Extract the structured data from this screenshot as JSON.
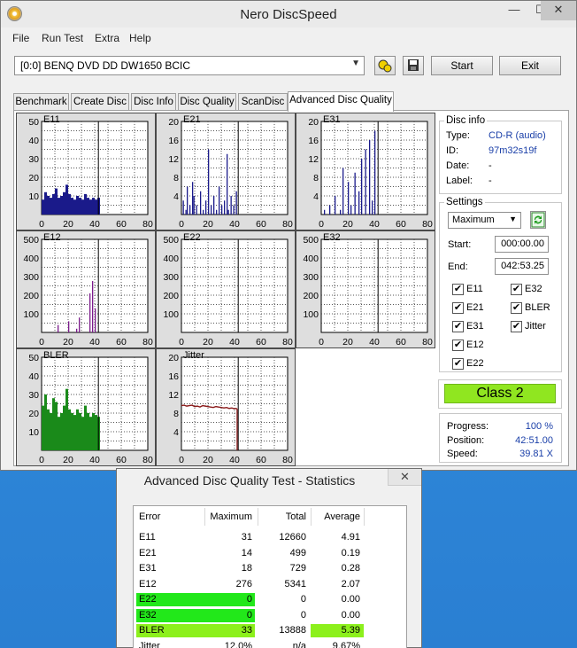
{
  "window": {
    "title": "Nero DiscSpeed",
    "minimize": "—",
    "maximize": "☐",
    "close": "✕"
  },
  "menu": [
    "File",
    "Run Test",
    "Extra",
    "Help"
  ],
  "toolbar": {
    "drive": "[0:0]   BENQ DVD DD DW1650 BCIC",
    "start": "Start",
    "exit": "Exit"
  },
  "tabs": [
    "Benchmark",
    "Create Disc",
    "Disc Info",
    "Disc Quality",
    "ScanDisc",
    "Advanced Disc Quality"
  ],
  "disc_info": {
    "title": "Disc info",
    "rows": [
      {
        "label": "Type:",
        "value": "CD-R (audio)"
      },
      {
        "label": "ID:",
        "value": "97m32s19f"
      },
      {
        "label": "Date:",
        "value": "-"
      },
      {
        "label": "Label:",
        "value": "-"
      }
    ]
  },
  "settings": {
    "title": "Settings",
    "mode": "Maximum",
    "start_label": "Start:",
    "start_value": "000:00.00",
    "end_label": "End:",
    "end_value": "042:53.25",
    "checks": [
      {
        "label": "E11",
        "checked": "✔"
      },
      {
        "label": "E32",
        "checked": "✔"
      },
      {
        "label": "E21",
        "checked": "✔"
      },
      {
        "label": "BLER",
        "checked": "✔"
      },
      {
        "label": "E31",
        "checked": "✔"
      },
      {
        "label": "Jitter",
        "checked": "✔"
      },
      {
        "label": "E12",
        "checked": "✔"
      },
      {
        "label": "E22",
        "checked": "✔"
      }
    ]
  },
  "quality_class": "Class 2",
  "progress": {
    "rows": [
      {
        "label": "Progress:",
        "value": "100 %"
      },
      {
        "label": "Position:",
        "value": "42:51.00"
      },
      {
        "label": "Speed:",
        "value": "39.81 X"
      }
    ]
  },
  "colors": {
    "e_series": "#1a1a8a",
    "e12_series": "#7a1a8a",
    "bler_series": "#1a8a1a",
    "jitter_series": "#8a1a1a",
    "class_badge": "#90e620"
  },
  "chart_data": [
    {
      "type": "bar",
      "title": "E11",
      "ylim": [
        0,
        50
      ],
      "yticks": [
        10,
        20,
        30,
        40,
        50
      ],
      "xticks": [
        0,
        20,
        40,
        60,
        80
      ],
      "xlim": [
        0,
        80
      ],
      "marker_x": 42.8,
      "x": [
        0,
        2,
        4,
        6,
        8,
        10,
        12,
        14,
        16,
        18,
        20,
        22,
        24,
        26,
        28,
        30,
        32,
        34,
        36,
        38,
        40,
        42
      ],
      "values": [
        8,
        12,
        10,
        9,
        11,
        14,
        9,
        10,
        12,
        16,
        11,
        9,
        8,
        10,
        9,
        8,
        11,
        9,
        8,
        9,
        8,
        9
      ]
    },
    {
      "type": "bar",
      "title": "E21",
      "ylim": [
        0,
        20
      ],
      "yticks": [
        4,
        8,
        12,
        16,
        20
      ],
      "xticks": [
        0,
        20,
        40,
        60,
        80
      ],
      "xlim": [
        0,
        80
      ],
      "marker_x": 42.8,
      "x": [
        1,
        3,
        4,
        6,
        8,
        9,
        11,
        14,
        16,
        18,
        20,
        22,
        24,
        26,
        28,
        30,
        32,
        34,
        35,
        37,
        39,
        41
      ],
      "values": [
        3,
        1,
        6,
        2,
        7,
        4,
        2,
        5,
        1,
        3,
        14,
        2,
        4,
        1,
        6,
        2,
        3,
        13,
        1,
        4,
        2,
        5
      ]
    },
    {
      "type": "bar",
      "title": "E31",
      "ylim": [
        0,
        20
      ],
      "yticks": [
        4,
        8,
        12,
        16,
        20
      ],
      "xticks": [
        0,
        20,
        40,
        60,
        80
      ],
      "xlim": [
        0,
        80
      ],
      "marker_x": 42.8,
      "x": [
        2,
        6,
        10,
        14,
        16,
        20,
        22,
        25,
        28,
        30,
        33,
        36,
        38,
        40
      ],
      "values": [
        1,
        2,
        4,
        1,
        10,
        7,
        2,
        9,
        5,
        12,
        14,
        16,
        3,
        18
      ]
    },
    {
      "type": "bar",
      "title": "E12",
      "ylim": [
        0,
        500
      ],
      "yticks": [
        100,
        200,
        300,
        400,
        500
      ],
      "xticks": [
        0,
        20,
        40,
        60,
        80
      ],
      "xlim": [
        0,
        80
      ],
      "marker_x": 42.8,
      "x": [
        12,
        20,
        26,
        28,
        36,
        38,
        40
      ],
      "values": [
        40,
        60,
        20,
        80,
        210,
        276,
        130
      ]
    },
    {
      "type": "bar",
      "title": "E22",
      "ylim": [
        0,
        500
      ],
      "yticks": [
        100,
        200,
        300,
        400,
        500
      ],
      "xticks": [
        0,
        20,
        40,
        60,
        80
      ],
      "xlim": [
        0,
        80
      ],
      "marker_x": 42.8,
      "x": [],
      "values": []
    },
    {
      "type": "bar",
      "title": "E32",
      "ylim": [
        0,
        500
      ],
      "yticks": [
        100,
        200,
        300,
        400,
        500
      ],
      "xticks": [
        0,
        20,
        40,
        60,
        80
      ],
      "xlim": [
        0,
        80
      ],
      "marker_x": 42.8,
      "x": [],
      "values": []
    },
    {
      "type": "bar",
      "title": "BLER",
      "ylim": [
        0,
        50
      ],
      "yticks": [
        10,
        20,
        30,
        40,
        50
      ],
      "xticks": [
        0,
        20,
        40,
        60,
        80
      ],
      "xlim": [
        0,
        80
      ],
      "marker_x": 42.8,
      "x": [
        0,
        2,
        4,
        6,
        8,
        10,
        12,
        14,
        16,
        18,
        20,
        22,
        24,
        26,
        28,
        30,
        32,
        34,
        36,
        38,
        40,
        42
      ],
      "values": [
        24,
        30,
        22,
        20,
        28,
        26,
        18,
        20,
        24,
        33,
        22,
        20,
        19,
        22,
        20,
        18,
        24,
        20,
        18,
        20,
        19,
        18
      ]
    },
    {
      "type": "line",
      "title": "Jitter",
      "ylim": [
        0,
        20
      ],
      "yticks": [
        4,
        8,
        12,
        16,
        20
      ],
      "xticks": [
        0,
        20,
        40,
        60,
        80
      ],
      "xlim": [
        0,
        80
      ],
      "marker_x": 42.8,
      "x": [
        0,
        2,
        4,
        6,
        8,
        10,
        12,
        14,
        16,
        18,
        20,
        22,
        24,
        26,
        28,
        30,
        32,
        34,
        36,
        38,
        40,
        41,
        42
      ],
      "values": [
        9.6,
        9.7,
        9.5,
        9.6,
        9.7,
        9.4,
        9.5,
        9.3,
        9.6,
        9.5,
        9.4,
        9.3,
        9.2,
        9.4,
        9.3,
        9.2,
        9.1,
        9.2,
        9.0,
        9.1,
        8.9,
        9.0,
        8.9
      ]
    }
  ],
  "statistics": {
    "title": "Advanced Disc Quality Test - Statistics",
    "close": "✕",
    "headers": [
      "Error",
      "Maximum",
      "Total",
      "Average"
    ],
    "rows": [
      [
        "E11",
        "31",
        "12660",
        "4.91"
      ],
      [
        "E21",
        "14",
        "499",
        "0.19"
      ],
      [
        "E31",
        "18",
        "729",
        "0.28"
      ],
      [
        "E12",
        "276",
        "5341",
        "2.07"
      ],
      [
        "E22",
        "0",
        "0",
        "0.00"
      ],
      [
        "E32",
        "0",
        "0",
        "0.00"
      ],
      [
        "BLER",
        "33",
        "13888",
        "5.39"
      ],
      [
        "Jitter",
        "12.0%",
        "n/a",
        "9.67%"
      ]
    ]
  }
}
